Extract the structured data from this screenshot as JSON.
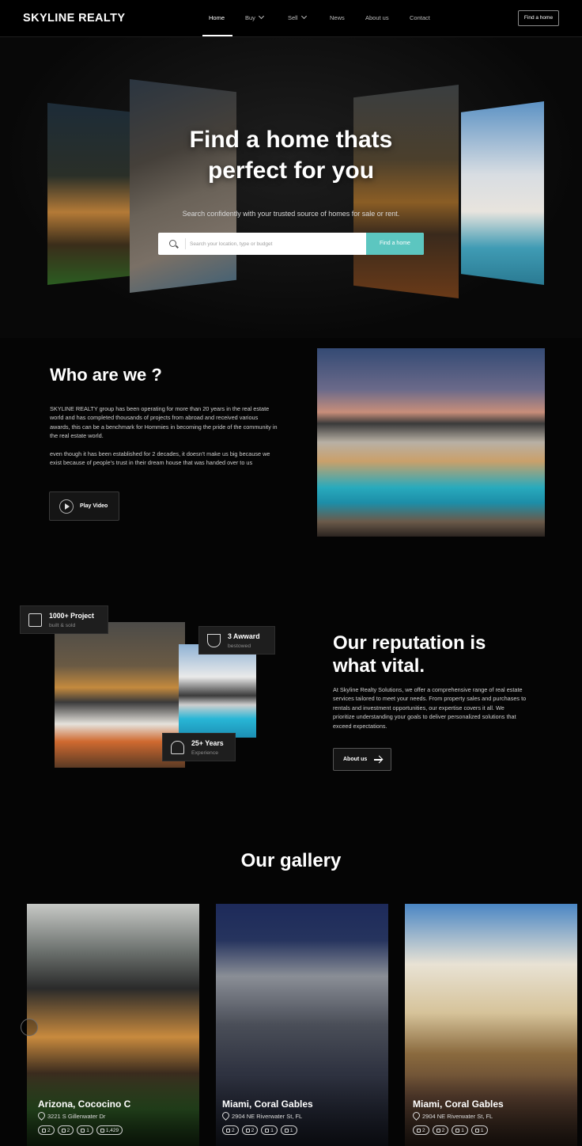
{
  "nav": {
    "logo": "SKYLINE REALTY",
    "items": [
      "Home",
      "Buy",
      "Sell",
      "News",
      "About us",
      "Contact"
    ],
    "cta": "Find a home"
  },
  "hero": {
    "title_line1": "Find a home thats",
    "title_line2": "perfect for you",
    "subtitle": "Search confidently with your trusted source of homes for sale or rent.",
    "search_placeholder": "Search your location, type or budget",
    "search_button": "Find a home"
  },
  "who": {
    "title": "Who are we ?",
    "p1": "SKYLINE REALTY group has been operating for more than 20 years in the real estate world and has completed thousands of projects from abroad and received various awards, this can be a benchmark for Hommies in becoming the pride of the community in the real estate world.",
    "p2": "even though it has been established for 2 decades, it doesn't make us big because we exist because of people's trust in their dream house that was handed over to us",
    "play_label": "Play Video"
  },
  "reputation": {
    "badges": [
      {
        "title": "1000+ Project",
        "sub": "built & sold",
        "icon": "building-icon"
      },
      {
        "title": "3 Awward",
        "sub": "bestowed",
        "icon": "trophy-icon"
      },
      {
        "title": "25+ Years",
        "sub": "Experience",
        "icon": "team-icon"
      }
    ],
    "title_line1": "Our reputation is",
    "title_line2": "what vital.",
    "paragraph": "At Skyline Realty Solutions, we offer a comprehensive range of real estate services tailored to meet your needs. From property sales and purchases to rentals and investment opportunities, our expertise covers it all. We prioritize understanding your goals to deliver personalized solutions that exceed expectations.",
    "button": "About us"
  },
  "gallery": {
    "title": "Our gallery",
    "cards": [
      {
        "title": "Arizona, Cococino C",
        "address": "3221 S Gillenwater Dr",
        "features": [
          "2",
          "2",
          "1",
          "1,429"
        ]
      },
      {
        "title": "Miami, Coral Gables",
        "address": "2904 NE Riverwater St, FL",
        "features": [
          "2",
          "2",
          "1",
          "1"
        ]
      },
      {
        "title": "Miami, Coral Gables",
        "address": "2904 NE Riverwater St, FL",
        "features": [
          "2",
          "2",
          "1",
          "1"
        ]
      }
    ]
  },
  "colors": {
    "accent": "#5cc6c0",
    "background": "#050505"
  }
}
